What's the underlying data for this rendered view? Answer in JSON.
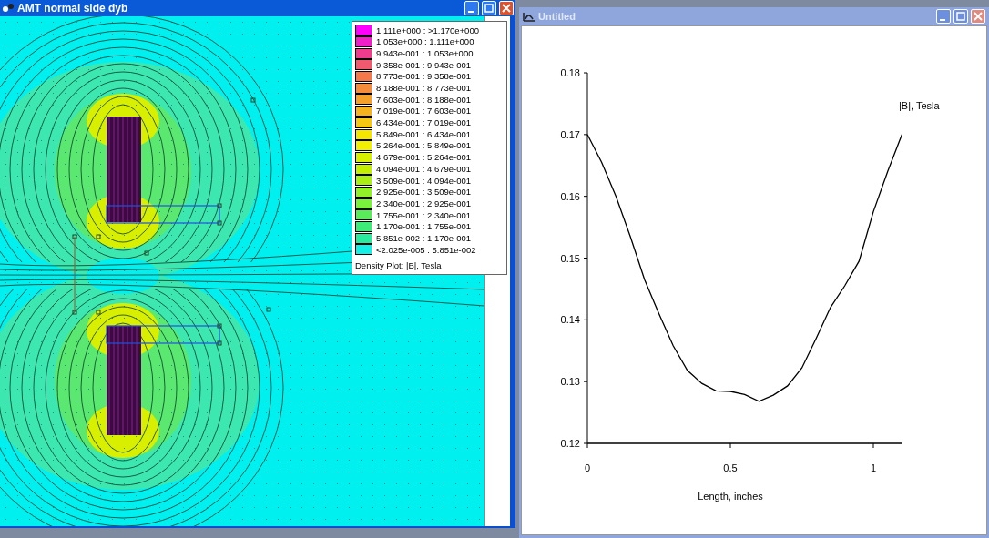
{
  "windows": [
    {
      "title": "AMT normal side dyb",
      "active": true,
      "legend": {
        "entries": [
          {
            "label": "1.111e+000 : >1.170e+000",
            "color": "#ff00ff"
          },
          {
            "label": "1.053e+000 : 1.111e+000",
            "color": "#f020c8"
          },
          {
            "label": "9.943e-001 : 1.053e+000",
            "color": "#f03c8c"
          },
          {
            "label": "9.358e-001 : 9.943e-001",
            "color": "#f05a6e"
          },
          {
            "label": "8.773e-001 : 9.358e-001",
            "color": "#f5784b"
          },
          {
            "label": "8.188e-001 : 8.773e-001",
            "color": "#f58c3c"
          },
          {
            "label": "7.603e-001 : 8.188e-001",
            "color": "#f5a028"
          },
          {
            "label": "7.019e-001 : 7.603e-001",
            "color": "#f5b41e"
          },
          {
            "label": "6.434e-001 : 7.019e-001",
            "color": "#f5c814"
          },
          {
            "label": "5.849e-001 : 6.434e-001",
            "color": "#f5e600"
          },
          {
            "label": "5.264e-001 : 5.849e-001",
            "color": "#f0f000"
          },
          {
            "label": "4.679e-001 : 5.264e-001",
            "color": "#d7f000"
          },
          {
            "label": "4.094e-001 : 4.679e-001",
            "color": "#c3f000"
          },
          {
            "label": "3.509e-001 : 4.094e-001",
            "color": "#aaf014"
          },
          {
            "label": "2.925e-001 : 3.509e-001",
            "color": "#91f028"
          },
          {
            "label": "2.340e-001 : 2.925e-001",
            "color": "#78f03c"
          },
          {
            "label": "1.755e-001 : 2.340e-001",
            "color": "#5aeb5a"
          },
          {
            "label": "1.170e-001 : 1.755e-001",
            "color": "#3ceb78"
          },
          {
            "label": "5.851e-002 : 1.170e-001",
            "color": "#28eba0"
          },
          {
            "label": "<2.025e-005 : 5.851e-002",
            "color": "#14f0e6"
          }
        ],
        "caption": "Density Plot: |B|, Tesla"
      }
    },
    {
      "title": "Untitled",
      "active": false,
      "chart_data": {
        "type": "line",
        "xlabel": "Length, inches",
        "x": [
          0,
          0.05,
          0.1,
          0.15,
          0.2,
          0.25,
          0.3,
          0.35,
          0.4,
          0.45,
          0.5,
          0.55,
          0.6,
          0.65,
          0.7,
          0.75,
          0.8,
          0.85,
          0.9,
          0.95,
          1.0,
          1.05,
          1.1
        ],
        "series": [
          {
            "name": "|B|, Tesla",
            "color": "#000000",
            "values": [
              0.17,
              0.1655,
              0.16,
              0.1535,
              0.1465,
              0.141,
              0.1358,
              0.1318,
              0.1297,
              0.1285,
              0.1284,
              0.1279,
              0.1268,
              0.1278,
              0.1293,
              0.1322,
              0.137,
              0.142,
              0.1455,
              0.1495,
              0.1575,
              0.164,
              0.17
            ]
          }
        ],
        "xlim": [
          0,
          1.1
        ],
        "ylim": [
          0.12,
          0.18
        ],
        "xticks": [
          0,
          0.5,
          1
        ],
        "yticks": [
          0.12,
          0.13,
          0.14,
          0.15,
          0.16,
          0.17,
          0.18
        ]
      }
    }
  ]
}
